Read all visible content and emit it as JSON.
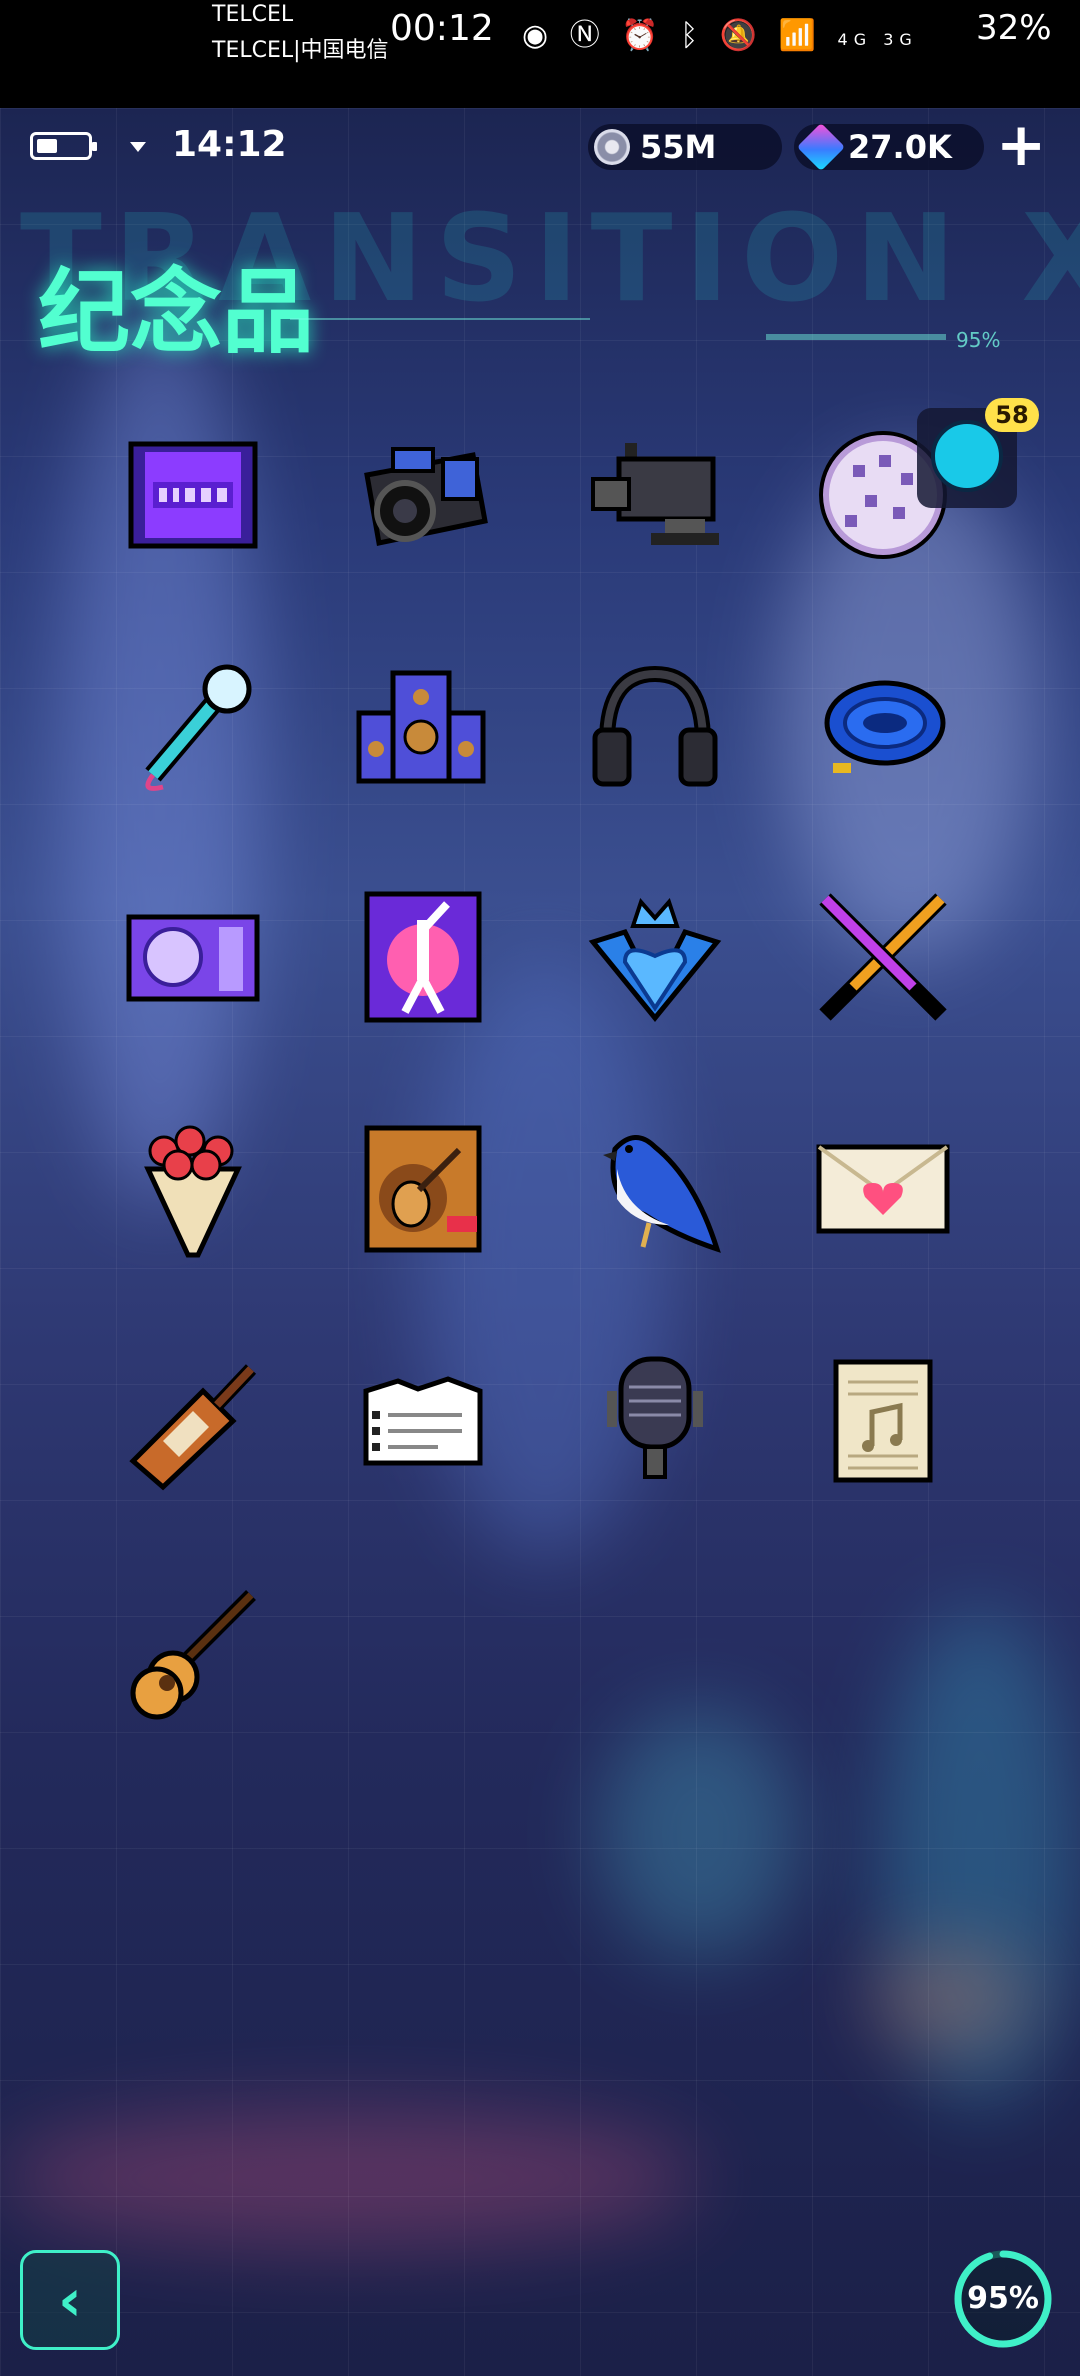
{
  "status_bar": {
    "carrier_1": "TELCEL",
    "carrier_2": "TELCEL|中国电信",
    "time": "00:12",
    "signal_labels": "4G 3G",
    "battery": "32%"
  },
  "top_bar": {
    "time": "14:12",
    "coins": "55M",
    "gems": "27.0K",
    "plus_label": "+"
  },
  "header": {
    "title": "纪念品",
    "background_text": "TRANSITION XXX",
    "deco_percent": "95%"
  },
  "collection": {
    "items": [
      {
        "icon": "disco-ticket-icon"
      },
      {
        "icon": "camera-icon"
      },
      {
        "icon": "video-camera-icon"
      },
      {
        "icon": "disco-ball-icon"
      },
      {
        "icon": "microphone-icon"
      },
      {
        "icon": "speakers-icon"
      },
      {
        "icon": "headphones-icon"
      },
      {
        "icon": "cable-coil-icon"
      },
      {
        "icon": "disco-card-icon"
      },
      {
        "icon": "dancer-poster-icon"
      },
      {
        "icon": "crowned-heart-icon"
      },
      {
        "icon": "crossed-lightsticks-icon"
      },
      {
        "icon": "flower-bouquet-icon"
      },
      {
        "icon": "guitar-poster-icon"
      },
      {
        "icon": "bluebird-icon"
      },
      {
        "icon": "love-letter-icon"
      },
      {
        "icon": "wine-bottle-icon"
      },
      {
        "icon": "note-card-icon"
      },
      {
        "icon": "retro-microphone-icon"
      },
      {
        "icon": "sheet-music-icon"
      },
      {
        "icon": "acoustic-guitar-icon"
      }
    ]
  },
  "helper": {
    "badge": "58"
  },
  "footer": {
    "progress_label": "95%",
    "progress_value": 0.95,
    "back_label": "‹"
  },
  "colors": {
    "accent": "#52ffd0",
    "badge": "#ffe14a",
    "background": "#0b0f2a"
  }
}
